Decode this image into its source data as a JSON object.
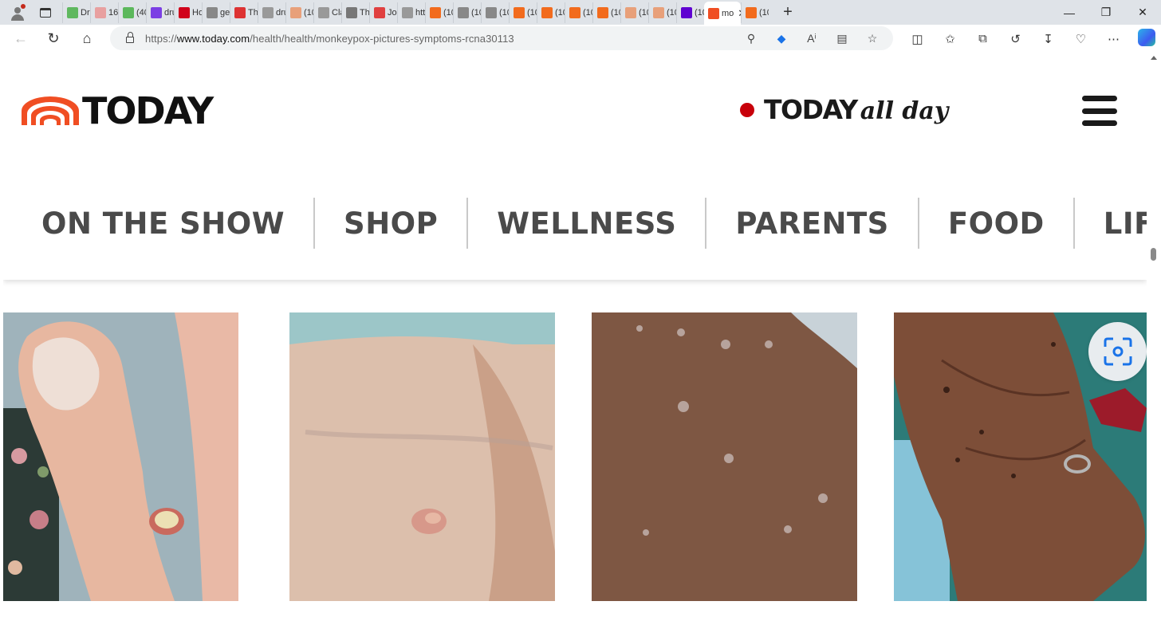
{
  "browser": {
    "tabs": [
      {
        "label": "Dr.",
        "icon": "play-icon",
        "color": "#5fb85f"
      },
      {
        "label": "16(",
        "icon": "bi-icon",
        "color": "#e8a0a0"
      },
      {
        "label": "(40",
        "icon": "g-icon",
        "color": "#5cb85c"
      },
      {
        "label": "dru",
        "icon": "yahoo-icon",
        "color": "#7b3fe4"
      },
      {
        "label": "Ho",
        "icon": "pin-icon",
        "color": "#d0021b"
      },
      {
        "label": "get",
        "icon": "search-icon",
        "color": "#888888"
      },
      {
        "label": "The",
        "icon": "ds-icon",
        "color": "#d33"
      },
      {
        "label": "dru",
        "icon": "doc-icon",
        "color": "#999999"
      },
      {
        "label": "(10",
        "icon": "bookmark-icon",
        "color": "#e8a07a"
      },
      {
        "label": "Cla",
        "icon": "doc-icon",
        "color": "#999999"
      },
      {
        "label": "Thi",
        "icon": "tt-icon",
        "color": "#777777"
      },
      {
        "label": "Jou",
        "icon": "youtube-icon",
        "color": "#e04040"
      },
      {
        "label": "htt",
        "icon": "doc-icon",
        "color": "#999999"
      },
      {
        "label": "(10",
        "icon": "bookmark-icon",
        "color": "#f26b1d"
      },
      {
        "label": "(10",
        "icon": "image-icon",
        "color": "#888888"
      },
      {
        "label": "(10",
        "icon": "image-icon",
        "color": "#888888"
      },
      {
        "label": "(10",
        "icon": "bookmark-icon",
        "color": "#f26b1d"
      },
      {
        "label": "(10",
        "icon": "bookmark-icon",
        "color": "#f26b1d"
      },
      {
        "label": "(10",
        "icon": "bookmark-icon",
        "color": "#f26b1d"
      },
      {
        "label": "(10",
        "icon": "bookmark-icon",
        "color": "#f26b1d"
      },
      {
        "label": "(10",
        "icon": "bookmark-icon",
        "color": "#e8a07a"
      },
      {
        "label": "(10",
        "icon": "bookmark-icon",
        "color": "#e8a07a"
      },
      {
        "label": "(10",
        "icon": "yahoo-icon",
        "color": "#5f01d1"
      }
    ],
    "active_tab": {
      "label": "mo",
      "icon": "today-icon",
      "color": "#f04e23"
    },
    "last_tab": {
      "label": "(10",
      "icon": "bookmark-icon",
      "color": "#f26b1d"
    },
    "url_prefix": "https://",
    "url_domain": "www.today.com",
    "url_path": "/health/health/monkeypox-pictures-symptoms-rcna30113"
  },
  "site": {
    "logo_text": "TODAY",
    "allday_brand": "TODAY",
    "allday_suffix": "all day",
    "nav": [
      "ON THE SHOW",
      "SHOP",
      "WELLNESS",
      "PARENTS",
      "FOOD",
      "LIFE"
    ]
  },
  "colors": {
    "brand_orange": "#f04e23",
    "allday_red": "#c8000a",
    "nav_text": "#4a4a4a"
  }
}
